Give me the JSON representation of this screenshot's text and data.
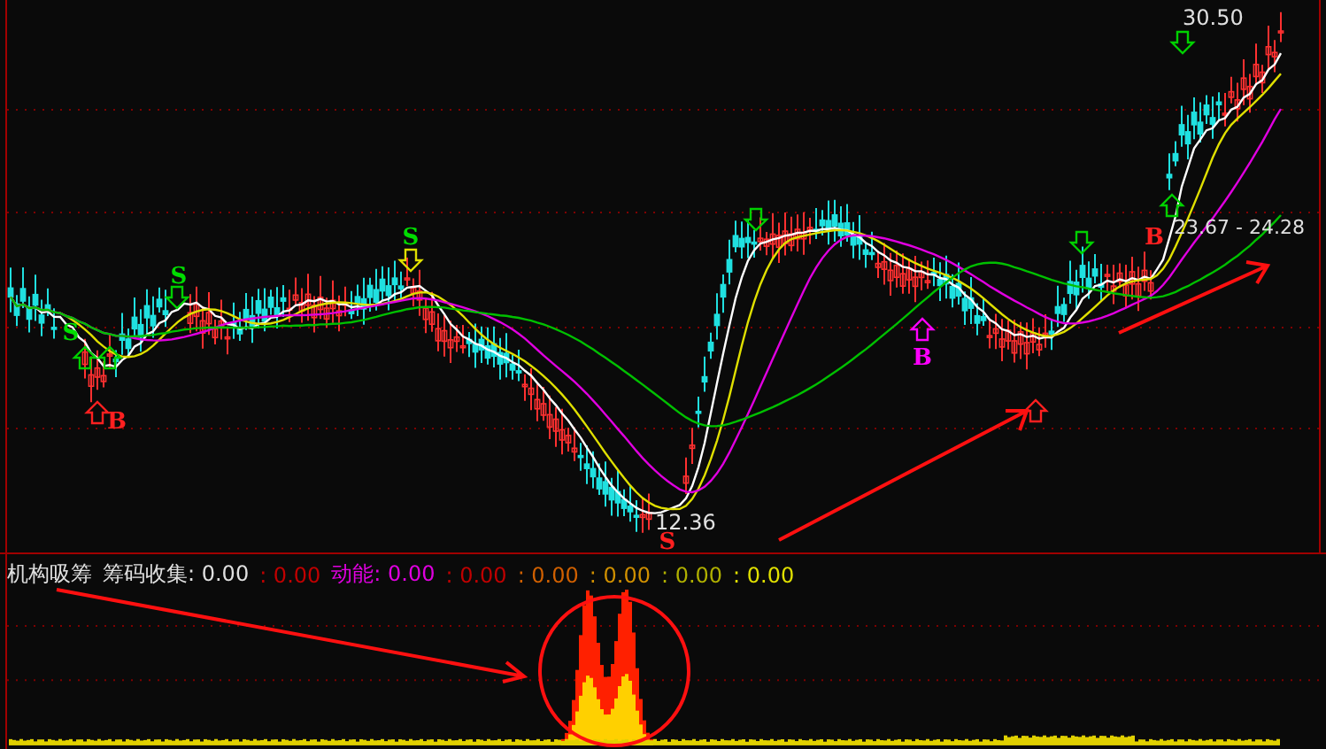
{
  "main_chart": {
    "price_labels": [
      {
        "kind": "high",
        "text": "30.50"
      },
      {
        "kind": "low",
        "text": "12.36"
      },
      {
        "kind": "range",
        "text": "23.67 - 24.28"
      }
    ],
    "signals": [
      {
        "text": "S",
        "color": "#00dd00"
      },
      {
        "text": "S",
        "color": "#00dd00"
      },
      {
        "text": "S",
        "color": "#00dd00"
      },
      {
        "text": "B",
        "color": "#ff2020"
      },
      {
        "text": "B",
        "color": "#ff00ff"
      },
      {
        "text": "B",
        "color": "#ff2020"
      },
      {
        "text": "S",
        "color": "#ff2020"
      }
    ]
  },
  "indicator": {
    "title": "机构吸筹",
    "items": [
      {
        "text": "筹码收集: 0.00",
        "color": "#e0e0e0"
      },
      {
        "text": ": 0.00",
        "color": "#c00000"
      },
      {
        "text": "动能: 0.00",
        "color": "#e000e0"
      },
      {
        "text": ": 0.00",
        "color": "#c00000"
      },
      {
        "text": ": 0.00",
        "color": "#d06000"
      },
      {
        "text": ": 0.00",
        "color": "#d09000"
      },
      {
        "text": ": 0.00",
        "color": "#b0b000"
      },
      {
        "text": ": 0.00",
        "color": "#e0e000"
      }
    ]
  }
}
